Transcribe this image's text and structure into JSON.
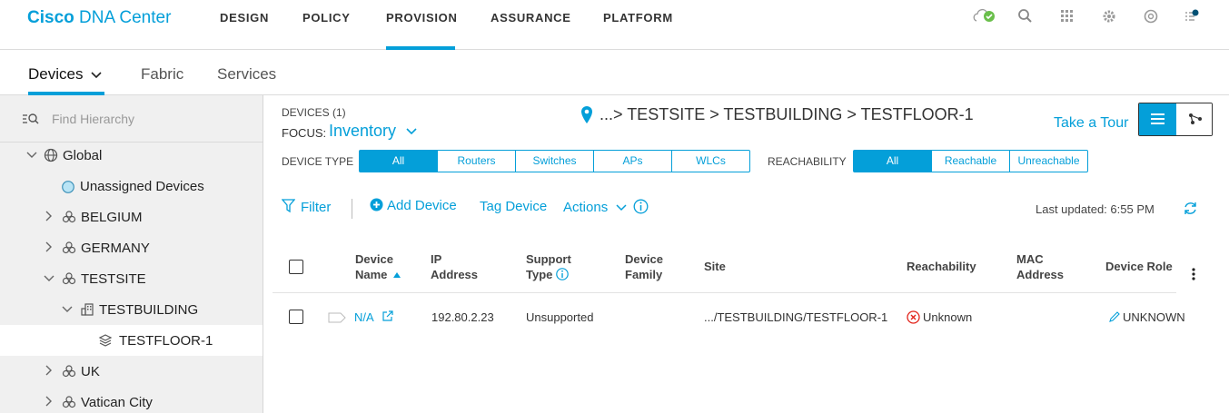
{
  "brand": {
    "bold": "Cisco",
    "rest": "DNA Center"
  },
  "topnav": {
    "items": [
      "DESIGN",
      "POLICY",
      "PROVISION",
      "ASSURANCE",
      "PLATFORM"
    ],
    "active": "PROVISION"
  },
  "subnav": {
    "items": [
      "Devices",
      "Fabric",
      "Services"
    ],
    "active": "Devices"
  },
  "sidebar": {
    "search_placeholder": "Find Hierarchy",
    "tree": [
      {
        "label": "Global",
        "expanded": true
      },
      {
        "label": "Unassigned Devices"
      },
      {
        "label": "BELGIUM",
        "expanded": false
      },
      {
        "label": "GERMANY",
        "expanded": false
      },
      {
        "label": "TESTSITE",
        "expanded": true
      },
      {
        "label": "TESTBUILDING",
        "expanded": true
      },
      {
        "label": "TESTFLOOR-1",
        "selected": true
      },
      {
        "label": "UK",
        "expanded": false
      },
      {
        "label": "Vatican City",
        "expanded": false
      }
    ]
  },
  "main": {
    "devices_count_label": "DEVICES (1)",
    "focus_label": "FOCUS:",
    "focus_value": "Inventory",
    "breadcrumb": "...> TESTSITE > TESTBUILDING > TESTFLOOR-1",
    "take_tour": "Take a Tour",
    "device_type_label": "DEVICE TYPE",
    "device_types": [
      "All",
      "Routers",
      "Switches",
      "APs",
      "WLCs"
    ],
    "device_type_selected": "All",
    "reachability_label": "REACHABILITY",
    "reachability_options": [
      "All",
      "Reachable",
      "Unreachable"
    ],
    "reachability_selected": "All",
    "filter": "Filter",
    "add_device": "Add Device",
    "tag_device": "Tag Device",
    "actions": "Actions",
    "last_updated": "Last updated: 6:55 PM"
  },
  "table": {
    "columns": [
      {
        "l1": "Device",
        "l2": "Name"
      },
      {
        "l1": "IP",
        "l2": "Address"
      },
      {
        "l1": "Support",
        "l2": "Type"
      },
      {
        "l1": "Device",
        "l2": "Family"
      },
      {
        "l1": "Site",
        "l2": ""
      },
      {
        "l1": "Reachability",
        "l2": ""
      },
      {
        "l1": "MAC",
        "l2": "Address"
      },
      {
        "l1": "Device Role",
        "l2": ""
      }
    ],
    "rows": [
      {
        "name": "N/A",
        "ip": "192.80.2.23",
        "support_type": "Unsupported",
        "family": "",
        "site": ".../TESTBUILDING/TESTFLOOR-1",
        "reachability": "Unknown",
        "mac": "",
        "role": "UNKNOWN"
      }
    ]
  },
  "colors": {
    "accent": "#049fd9",
    "error": "#e2231a",
    "status_ok": "#6abf4b"
  }
}
